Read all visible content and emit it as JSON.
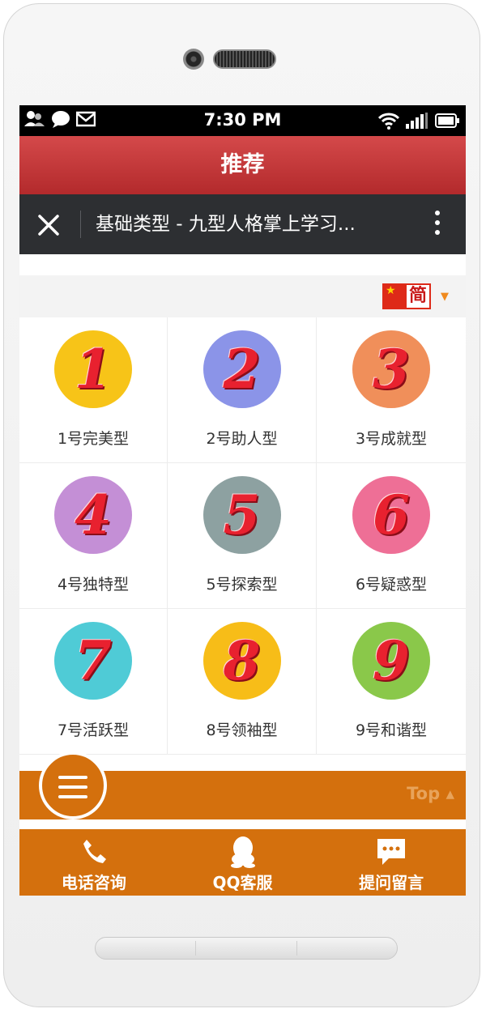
{
  "status_bar": {
    "time": "7:30 PM"
  },
  "app_bar": {
    "title": "推荐"
  },
  "nav_bar": {
    "title": "基础类型 - 九型人格掌上学习..."
  },
  "language": {
    "flag_text": "简"
  },
  "types": [
    {
      "number": "1",
      "label": "1号完美型",
      "color": "#f7c418"
    },
    {
      "number": "2",
      "label": "2号助人型",
      "color": "#8b94e8"
    },
    {
      "number": "3",
      "label": "3号成就型",
      "color": "#f08f5a"
    },
    {
      "number": "4",
      "label": "4号独特型",
      "color": "#c48fd6"
    },
    {
      "number": "5",
      "label": "5号探索型",
      "color": "#8da1a1"
    },
    {
      "number": "6",
      "label": "6号疑惑型",
      "color": "#ee6f96"
    },
    {
      "number": "7",
      "label": "7号活跃型",
      "color": "#4fcbd6"
    },
    {
      "number": "8",
      "label": "8号领袖型",
      "color": "#f7bd18"
    },
    {
      "number": "9",
      "label": "9号和谐型",
      "color": "#8ac84a"
    }
  ],
  "top_link": {
    "label": "Top ▴"
  },
  "bottom_nav": [
    {
      "label": "电话咨询",
      "icon": "phone-icon"
    },
    {
      "label": "QQ客服",
      "icon": "qq-icon"
    },
    {
      "label": "提问留言",
      "icon": "message-icon"
    }
  ],
  "colors": {
    "header_red": "#c0393a",
    "nav_dark": "#2d2f32",
    "accent_orange": "#d4700d"
  }
}
